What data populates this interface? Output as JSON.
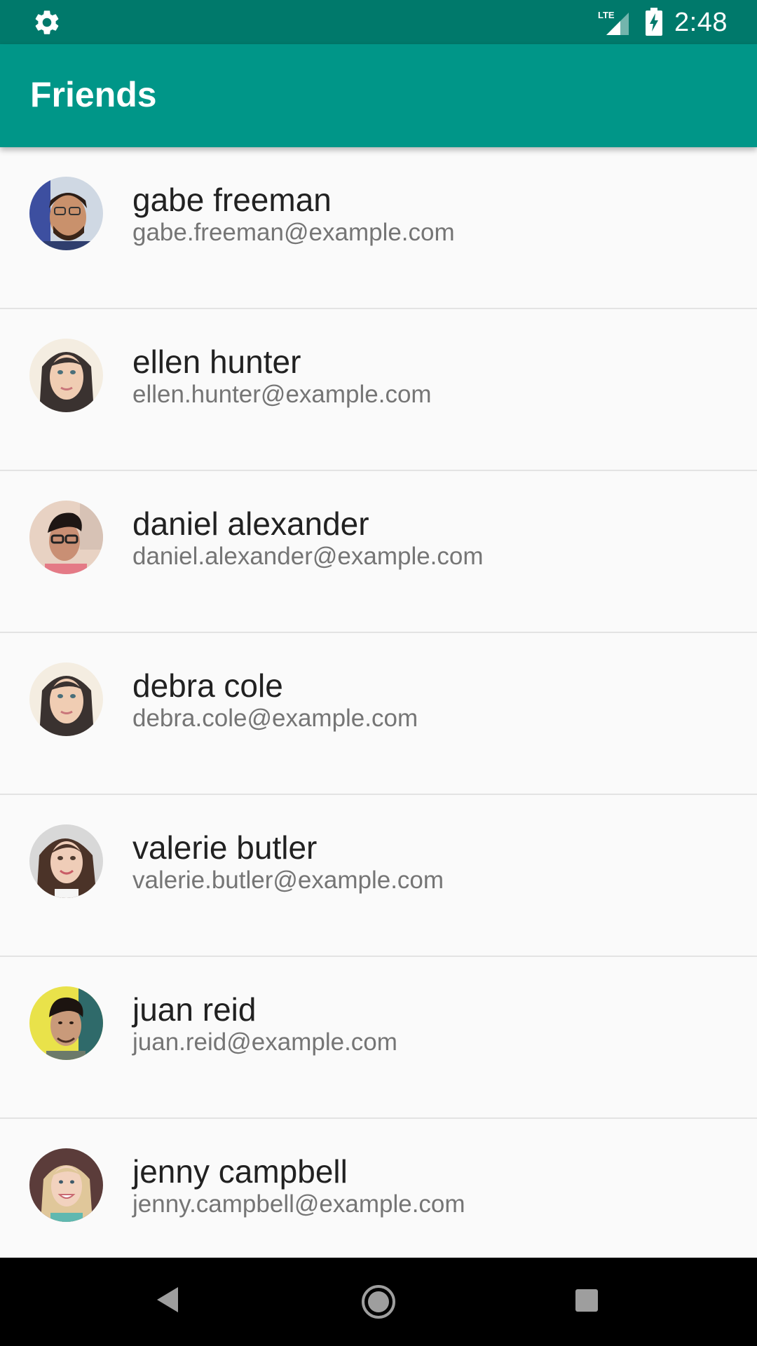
{
  "status_bar": {
    "time": "2:48",
    "network": "LTE",
    "icons": [
      "gear-icon",
      "lte-signal-icon",
      "battery-charging-icon"
    ]
  },
  "app_bar": {
    "title": "Friends",
    "color": "#009688",
    "status_color": "#00796b"
  },
  "friends": [
    {
      "name": "gabe freeman",
      "email": "gabe.freeman@example.com"
    },
    {
      "name": "ellen hunter",
      "email": "ellen.hunter@example.com"
    },
    {
      "name": "daniel alexander",
      "email": "daniel.alexander@example.com"
    },
    {
      "name": "debra cole",
      "email": "debra.cole@example.com"
    },
    {
      "name": "valerie butler",
      "email": "valerie.butler@example.com"
    },
    {
      "name": "juan reid",
      "email": "juan.reid@example.com"
    },
    {
      "name": "jenny campbell",
      "email": "jenny.campbell@example.com"
    }
  ],
  "nav_bar": {
    "icons": [
      "back-icon",
      "home-icon",
      "recents-icon"
    ]
  }
}
